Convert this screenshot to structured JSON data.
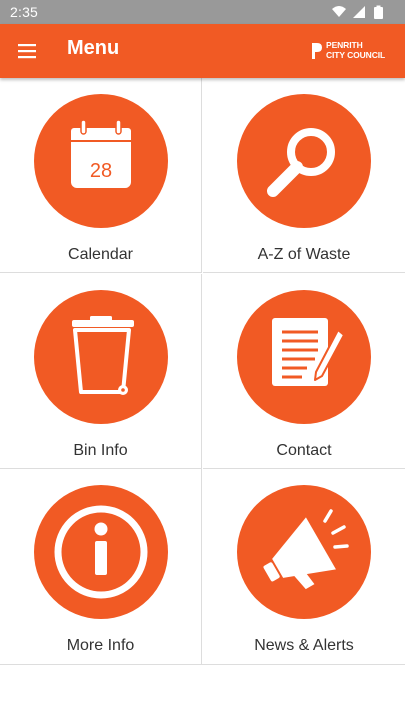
{
  "status_bar": {
    "time": "2:35",
    "icons": [
      "wifi-icon",
      "signal-icon",
      "battery-icon"
    ]
  },
  "app_bar": {
    "title": "Menu",
    "menu_icon": "hamburger-menu-icon",
    "brand_line1": "PENRITH",
    "brand_line2": "CITY COUNCIL"
  },
  "colors": {
    "accent": "#f15a24",
    "status_bar": "#999999",
    "label_text": "#333333",
    "divider": "#dddddd"
  },
  "calendar_day": "28",
  "menu_items": [
    {
      "label": "Calendar",
      "icon": "calendar-icon"
    },
    {
      "label": "A-Z of Waste",
      "icon": "magnifier-icon"
    },
    {
      "label": "Bin Info",
      "icon": "wheelie-bin-icon"
    },
    {
      "label": "Contact",
      "icon": "notepad-pen-icon"
    },
    {
      "label": "More Info",
      "icon": "info-icon"
    },
    {
      "label": "News & Alerts",
      "icon": "megaphone-icon"
    }
  ]
}
